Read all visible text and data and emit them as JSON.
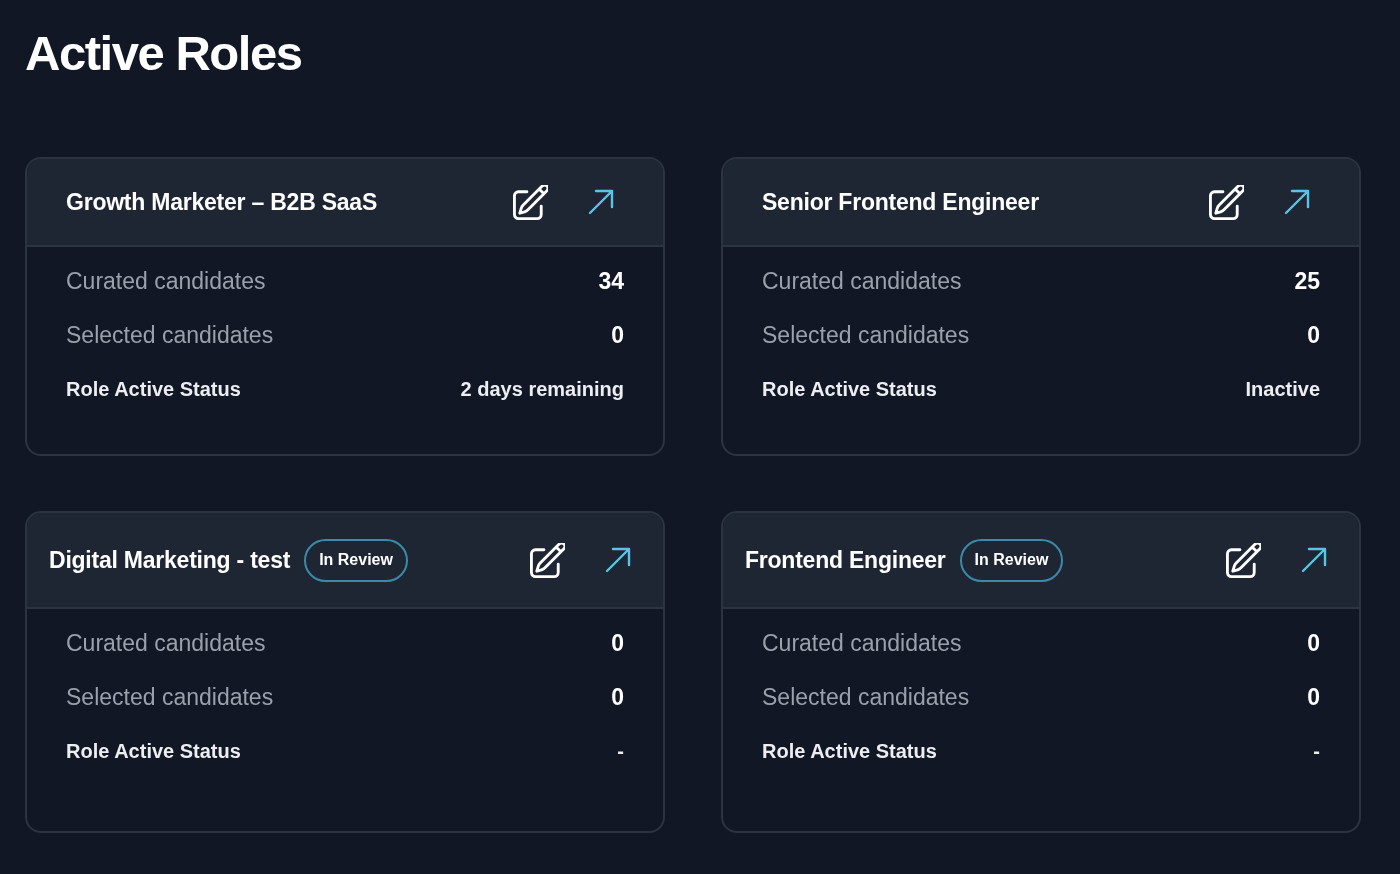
{
  "page": {
    "title": "Active Roles"
  },
  "roles": [
    {
      "title": "Growth Marketer – B2B SaaS",
      "stats": [
        {
          "kind": "count",
          "label": "Curated candidates",
          "value": "34"
        },
        {
          "kind": "count",
          "label": "Selected candidates",
          "value": "0"
        },
        {
          "kind": "status",
          "label": "Role Active Status",
          "value": "2 days remaining"
        }
      ]
    },
    {
      "title": "Senior Frontend Engineer",
      "stats": [
        {
          "kind": "count",
          "label": "Curated candidates",
          "value": "25"
        },
        {
          "kind": "count",
          "label": "Selected candidates",
          "value": "0"
        },
        {
          "kind": "status",
          "label": "Role Active Status",
          "value": "Inactive"
        }
      ]
    },
    {
      "title": "Digital Marketing - test",
      "badge": "In Review",
      "stats": [
        {
          "kind": "count",
          "label": "Curated candidates",
          "value": "0"
        },
        {
          "kind": "count",
          "label": "Selected candidates",
          "value": "0"
        },
        {
          "kind": "status",
          "label": "Role Active Status",
          "value": "-"
        }
      ]
    },
    {
      "title": "Frontend Engineer",
      "badge": "In Review",
      "stats": [
        {
          "kind": "count",
          "label": "Curated candidates",
          "value": "0"
        },
        {
          "kind": "count",
          "label": "Selected candidates",
          "value": "0"
        },
        {
          "kind": "status",
          "label": "Role Active Status",
          "value": "-"
        }
      ]
    }
  ]
}
